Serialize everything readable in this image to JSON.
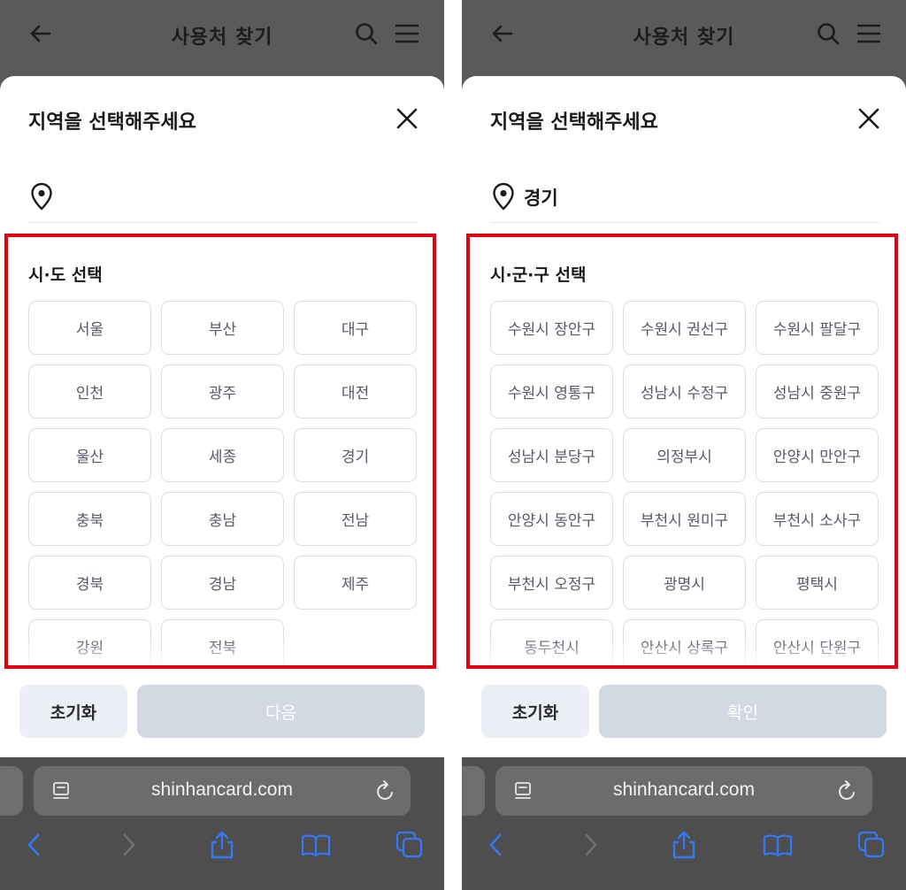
{
  "app": {
    "title": "사용처 찾기",
    "url": "shinhancard.com"
  },
  "screens": [
    {
      "sheet_title": "지역을 선택해주세요",
      "location_value": "",
      "section_title": "시·도 선택",
      "options": [
        "서울",
        "부산",
        "대구",
        "인천",
        "광주",
        "대전",
        "울산",
        "세종",
        "경기",
        "충북",
        "충남",
        "전남",
        "경북",
        "경남",
        "제주",
        "강원",
        "전북"
      ],
      "reset_label": "초기화",
      "primary_label": "다음"
    },
    {
      "sheet_title": "지역을 선택해주세요",
      "location_value": "경기",
      "section_title": "시·군·구 선택",
      "options": [
        "수원시 장안구",
        "수원시 권선구",
        "수원시 팔달구",
        "수원시 영통구",
        "성남시 수정구",
        "성남시 중원구",
        "성남시 분당구",
        "의정부시",
        "안양시 만안구",
        "안양시 동안구",
        "부천시 원미구",
        "부천시 소사구",
        "부천시 오정구",
        "광명시",
        "평택시",
        "동두천시",
        "안산시 상록구",
        "안산시 단원구"
      ],
      "reset_label": "초기화",
      "primary_label": "확인"
    }
  ],
  "colors": {
    "highlight_border": "#e3000f",
    "primary_disabled": "#d2d9e3",
    "reset_bg": "#eceff6",
    "ios_blue": "#3478f6"
  },
  "icons": [
    "back-arrow-icon",
    "search-icon",
    "menu-icon",
    "close-icon",
    "location-pin-icon",
    "reader-icon",
    "reload-icon",
    "back-chevron-icon",
    "forward-chevron-icon",
    "share-icon",
    "bookmarks-icon",
    "tabs-icon"
  ]
}
